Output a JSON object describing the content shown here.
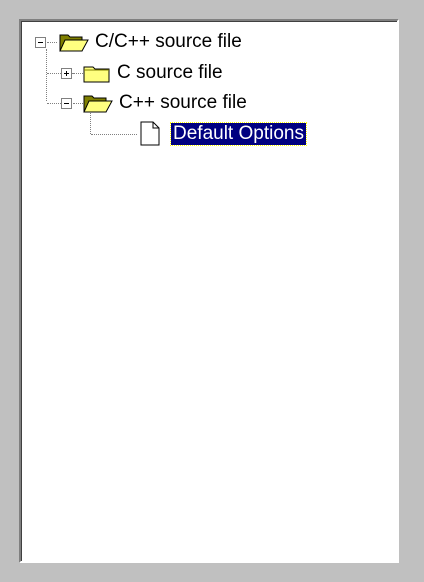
{
  "tree": {
    "nodes": [
      {
        "label": "C/C++ source file",
        "icon": "folder-open-icon",
        "expander": "minus"
      },
      {
        "label": "C source file",
        "icon": "folder-closed-icon",
        "expander": "plus"
      },
      {
        "label": "C++ source file",
        "icon": "folder-open-icon",
        "expander": "minus"
      },
      {
        "label": "Default Options",
        "icon": "document-icon",
        "selected": true
      }
    ]
  },
  "colors": {
    "window_bg": "#c0c0c0",
    "tree_bg": "#ffffff",
    "selection_bg": "#000080",
    "selection_text": "#ffffff",
    "folder_yellow": "#ffff80"
  }
}
